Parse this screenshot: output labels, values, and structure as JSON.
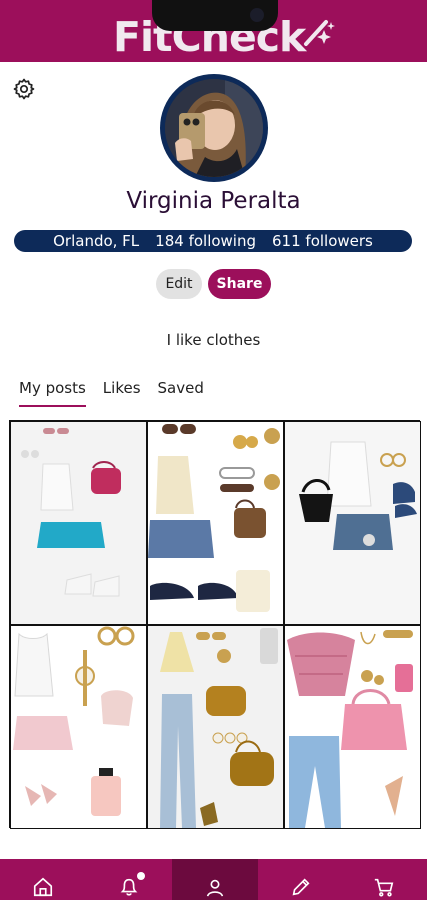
{
  "app": {
    "logo_text": "FitCheck",
    "brand_color": "#9c0f5b",
    "navy": "#0d2a59"
  },
  "profile": {
    "name": "Virginia Peralta",
    "location": "Orlando, FL",
    "following": "184 following",
    "followers": "611 followers",
    "bio": "I like clothes",
    "avatar_icon": "profile-photo"
  },
  "actions": {
    "edit_label": "Edit",
    "share_label": "Share"
  },
  "tabs": [
    {
      "label": "My posts",
      "active": true
    },
    {
      "label": "Likes",
      "active": false
    },
    {
      "label": "Saved",
      "active": false
    }
  ],
  "posts": [
    {
      "name": "outfit-white-top-blue-skirt"
    },
    {
      "name": "outfit-cream-cami-denim-skirt"
    },
    {
      "name": "outfit-white-tank-denim-shorts"
    },
    {
      "name": "outfit-white-tank-pink-skirt"
    },
    {
      "name": "outfit-yellow-halter-jeans"
    },
    {
      "name": "outfit-pink-lace-top-jeans"
    }
  ],
  "bottom_nav": [
    {
      "icon": "home-icon",
      "active": false
    },
    {
      "icon": "bell-icon",
      "active": false,
      "badge": true
    },
    {
      "icon": "profile-icon",
      "active": true
    },
    {
      "icon": "pencil-icon",
      "active": false
    },
    {
      "icon": "cart-icon",
      "active": false
    }
  ]
}
